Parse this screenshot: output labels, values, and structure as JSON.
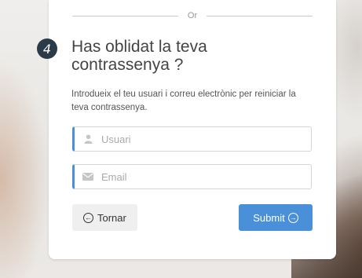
{
  "divider": {
    "text": "Or"
  },
  "step": {
    "number": "4"
  },
  "form": {
    "title": "Has oblidat la teva contrassenya ?",
    "description": "Introdueix el teu usuari i correu electrònic per reiniciar la teva contrassenya.",
    "username": {
      "placeholder": "Usuari",
      "value": "",
      "icon": "user-icon"
    },
    "email": {
      "placeholder": "Email",
      "value": "",
      "icon": "envelope-icon"
    }
  },
  "buttons": {
    "back_label": "Tornar",
    "back_icon": "circle-arrow-left-icon",
    "submit_label": "Submit",
    "submit_icon": "circle-arrow-right-icon"
  },
  "colors": {
    "accent": "#4a90d9",
    "step_badge": "#2a3b4a"
  }
}
